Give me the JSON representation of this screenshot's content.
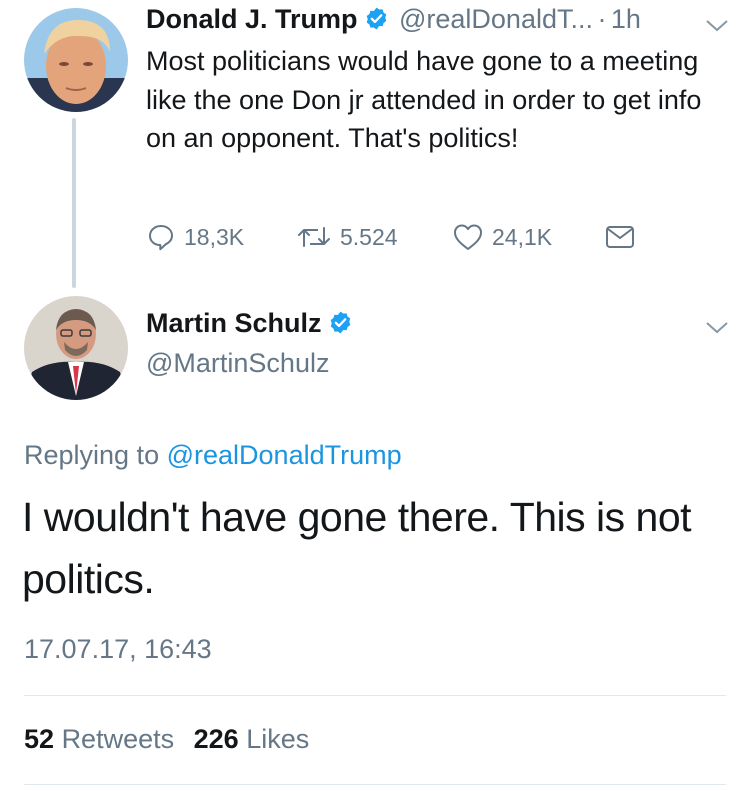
{
  "original_tweet": {
    "author_name": "Donald J. Trump",
    "author_handle": "@realDonaldT...",
    "separator": "·",
    "time_ago": "1h",
    "text": "Most politicians would have gone to a meeting like the one Don jr attended in order to get info on an opponent. That's politics!",
    "replies": "18,3K",
    "retweets": "5.524",
    "likes": "24,1K"
  },
  "reply_tweet": {
    "author_name": "Martin Schulz",
    "author_handle": "@MartinSchulz",
    "replying_to_prefix": "Replying to",
    "replying_to_handle": "@realDonaldTrump",
    "text": "I wouldn't have gone there. This is not politics.",
    "timestamp": "17.07.17, 16:43",
    "retweet_count": "52",
    "retweet_label": "Retweets",
    "like_count": "226",
    "like_label": "Likes"
  },
  "colors": {
    "verified": "#1da1f2",
    "link": "#1b95e0",
    "muted": "#657786",
    "thread_line": "#ccd6dd"
  },
  "icons": [
    "verified-badge-icon",
    "chevron-down-icon",
    "reply-icon",
    "retweet-icon",
    "heart-icon",
    "direct-message-icon"
  ]
}
